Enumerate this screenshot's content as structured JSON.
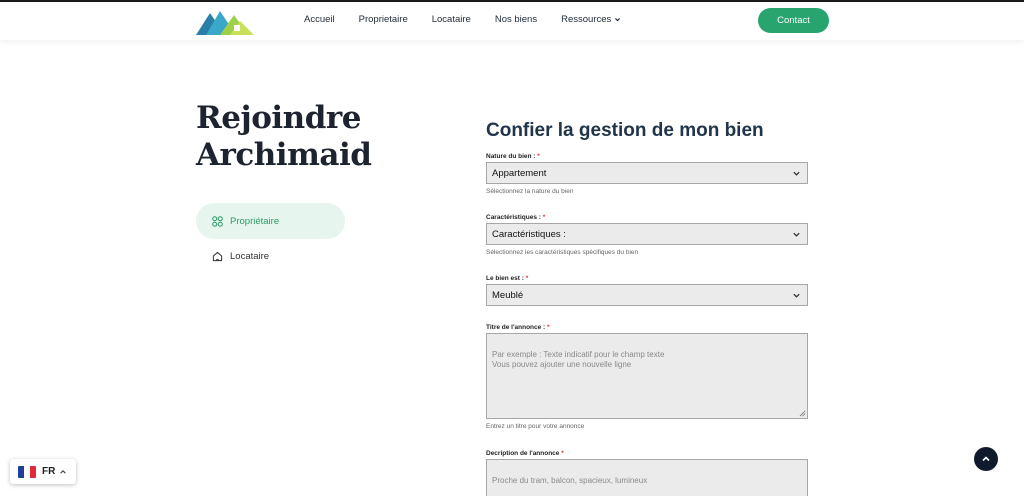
{
  "nav": {
    "items": [
      {
        "label": "Accueil"
      },
      {
        "label": "Proprietaire"
      },
      {
        "label": "Locataire"
      },
      {
        "label": "Nos biens"
      },
      {
        "label": "Ressources"
      }
    ],
    "contact_label": "Contact"
  },
  "hero": {
    "title_line1": "Rejoindre",
    "title_line2": "Archimaid"
  },
  "sidebar": {
    "items": [
      {
        "label": "Propriétaire",
        "active": true
      },
      {
        "label": "Locataire",
        "active": false
      }
    ]
  },
  "form": {
    "title": "Confier la gestion de mon bien",
    "fields": [
      {
        "label": "Nature du bien :",
        "required": "*",
        "value": "Appartement",
        "help": "Sélectionnez la nature du bien"
      },
      {
        "label": "Caractéristiques :",
        "required": "*",
        "value": "Caractéristiques :",
        "help": "Sélectionnez les caractéristiques spécifiques du bien"
      },
      {
        "label": "Le bien est :",
        "required": "*",
        "value": "Meublé"
      },
      {
        "label": "Titre de l'annonce :",
        "required": "*",
        "placeholder": "Par exemple : Texte indicatif pour le champ texte\nVous pouvez ajouter une nouvelle ligne",
        "help": "Entrez un titre pour votre annonce"
      },
      {
        "label": "Decription de l'annonce",
        "required": "*",
        "placeholder": "Proche du tram, balcon, spacieux, lumineux"
      }
    ]
  },
  "language": {
    "code": "FR"
  },
  "colors": {
    "accent": "#28a46e",
    "accent_light": "#e6f5ed",
    "dark": "#0f1b2d",
    "title": "#20354a"
  },
  "icons": {
    "logo": "house-logo",
    "sidebar_owner": "grid-circles-icon",
    "sidebar_tenant": "home-icon",
    "dropdown": "chevron-down-icon",
    "scroll": "chevron-up-icon",
    "flag": "france-flag-icon"
  }
}
